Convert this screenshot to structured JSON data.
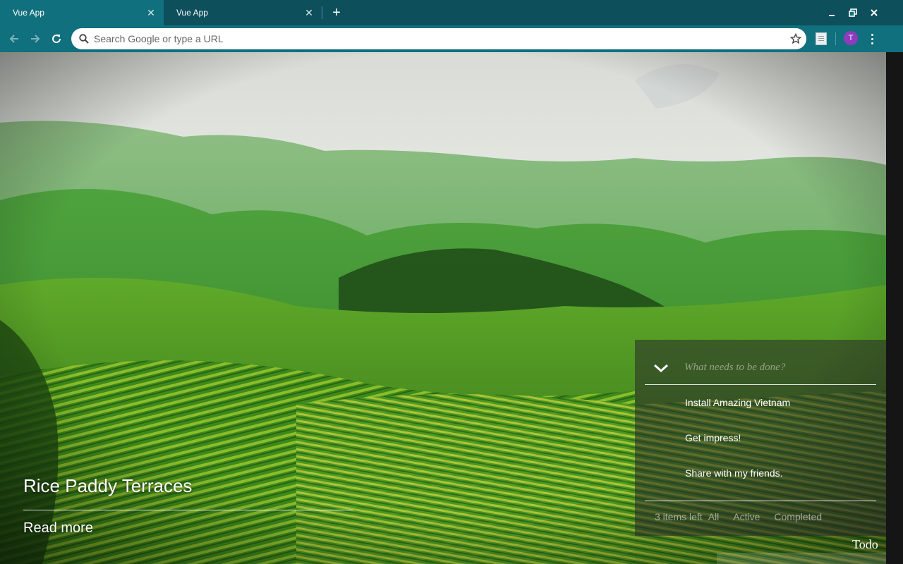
{
  "browser": {
    "tabs": [
      {
        "title": "Vue App",
        "active": true
      },
      {
        "title": "Vue App",
        "active": false
      }
    ],
    "omnibox": {
      "placeholder": "Search Google or type a URL",
      "value": ""
    },
    "profile_initial": "T",
    "accent_color": "#10707d",
    "tabbar_color": "#0d4f5b",
    "profile_color": "#8f3bbf"
  },
  "page": {
    "caption": {
      "title": "Rice Paddy Terraces",
      "link_label": "Read more"
    },
    "todo": {
      "new_todo_placeholder": "What needs to be done?",
      "items": [
        {
          "title": "Install Amazing Vietnam",
          "completed": false
        },
        {
          "title": "Get impress!",
          "completed": false
        },
        {
          "title": "Share with my friends.",
          "completed": false
        }
      ],
      "items_left": "3 items left",
      "filters": [
        "All",
        "Active",
        "Completed"
      ]
    },
    "nav_label": "Todo"
  }
}
